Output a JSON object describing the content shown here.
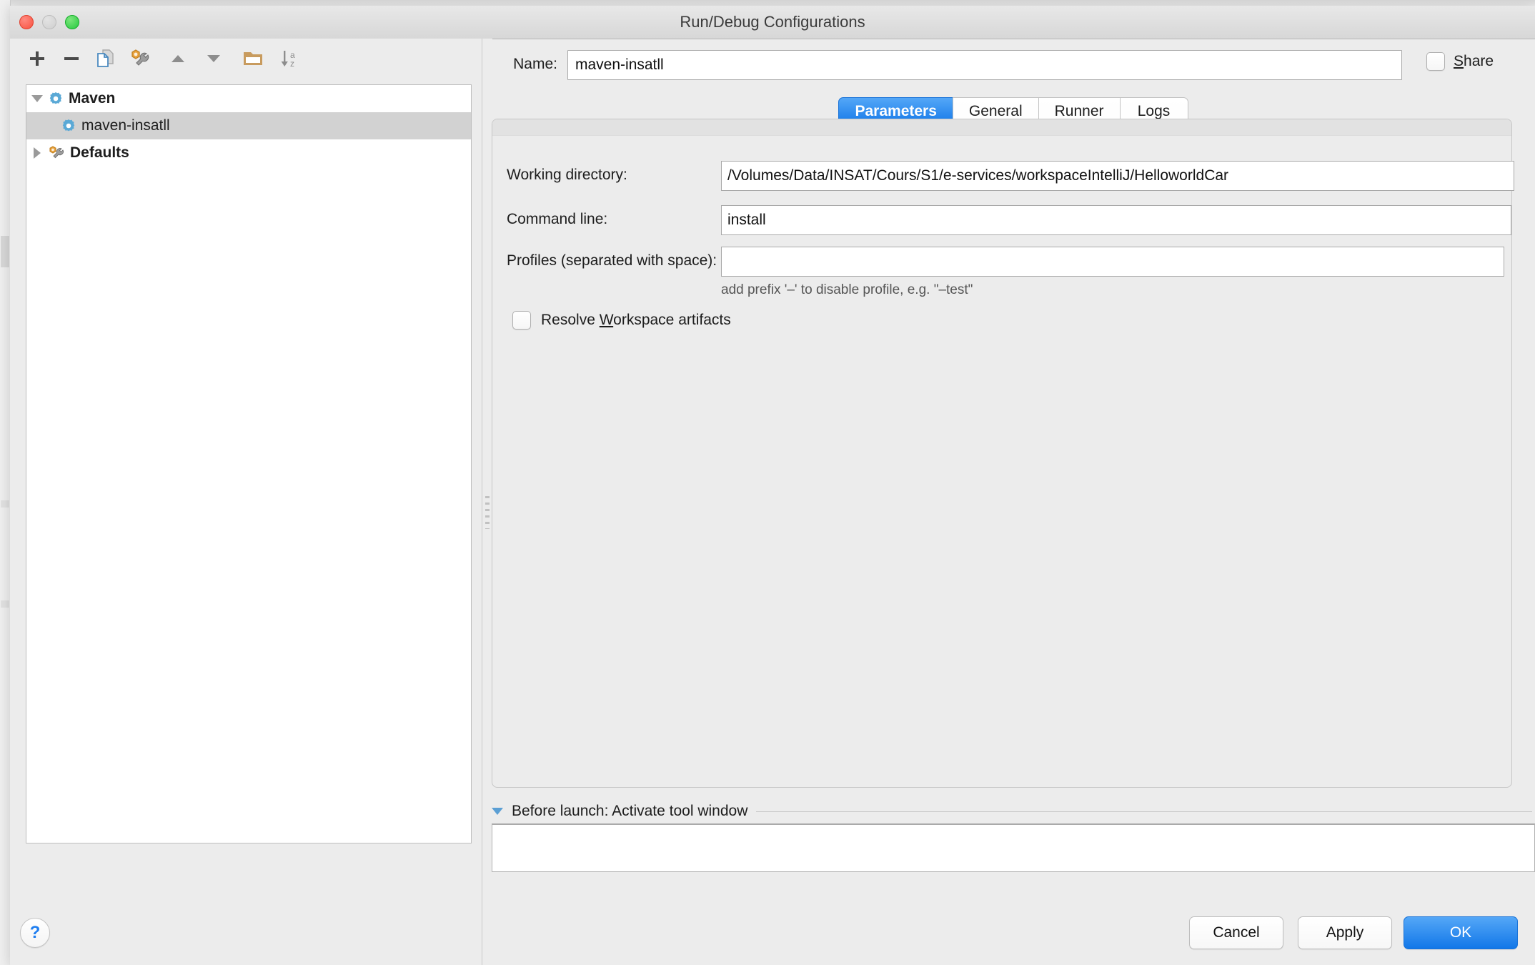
{
  "window": {
    "title": "Run/Debug Configurations",
    "traffic_lights": [
      "close",
      "minimize",
      "maximize"
    ]
  },
  "toolbar": {
    "items": [
      {
        "name": "add-configuration-button",
        "icon": "plus-icon",
        "label": "+"
      },
      {
        "name": "remove-configuration-button",
        "icon": "minus-icon",
        "label": "−"
      },
      {
        "name": "copy-configuration-button",
        "icon": "copy-icon",
        "label": "Copy Configuration"
      },
      {
        "name": "edit-defaults-button",
        "icon": "wrench-icon",
        "label": "Edit defaults"
      },
      {
        "name": "move-up-button",
        "icon": "triangle-up-icon",
        "label": "Move Up"
      },
      {
        "name": "move-down-button",
        "icon": "triangle-down-icon",
        "label": "Move Down"
      },
      {
        "name": "new-folder-button",
        "icon": "folder-icon",
        "label": "Create new folder"
      },
      {
        "name": "sort-configurations-button",
        "icon": "sort-az-icon",
        "label": "Sort configurations"
      }
    ]
  },
  "tree": {
    "nodes": [
      {
        "label": "Maven",
        "icon": "maven-gear-icon",
        "expanded": true,
        "bold": true,
        "indent": 0,
        "selected": false,
        "has_twisty": true
      },
      {
        "label": "maven-insatll",
        "icon": "maven-gear-icon",
        "expanded": false,
        "bold": false,
        "indent": 1,
        "selected": true,
        "has_twisty": false
      },
      {
        "label": "Defaults",
        "icon": "defaults-wrench-icon",
        "expanded": false,
        "bold": true,
        "indent": 0,
        "selected": false,
        "has_twisty": true
      }
    ]
  },
  "name_field": {
    "label": "Name:",
    "value": "maven-insatll",
    "placeholder": ""
  },
  "share": {
    "label_prefix": "",
    "mnemonic": "S",
    "label_suffix": "hare",
    "checked": false
  },
  "tabs": [
    {
      "label": "Parameters",
      "active": true
    },
    {
      "label": "General",
      "active": false
    },
    {
      "label": "Runner",
      "active": false
    },
    {
      "label": "Logs",
      "active": false
    }
  ],
  "parameters": {
    "working_directory": {
      "label": "Working directory:",
      "value": "/Volumes/Data/INSAT/Cours/S1/e-services/workspaceIntelliJ/HelloworldCar"
    },
    "command_line": {
      "label": "Command line:",
      "value": "install"
    },
    "profiles": {
      "label": "Profiles (separated with space):",
      "value": "",
      "hint": "add prefix '–' to disable profile, e.g. \"–test\""
    },
    "resolve_workspace": {
      "label_prefix": "Resolve ",
      "mnemonic": "W",
      "label_suffix": "orkspace artifacts",
      "checked": false
    }
  },
  "before_launch": {
    "title": "Before launch: Activate tool window",
    "expanded": true,
    "items": []
  },
  "footer": {
    "help_label": "?",
    "cancel_label": "Cancel",
    "apply_label": "Apply",
    "ok_label": "OK"
  },
  "colors": {
    "accent_blue": "#1277e8",
    "selection_gray": "#d2d2d2",
    "dialog_bg": "#ececec",
    "maven_icon_blue": "#5aa9d6",
    "folder_orange": "#c89b5e",
    "help_blue": "#1f7ef0"
  }
}
